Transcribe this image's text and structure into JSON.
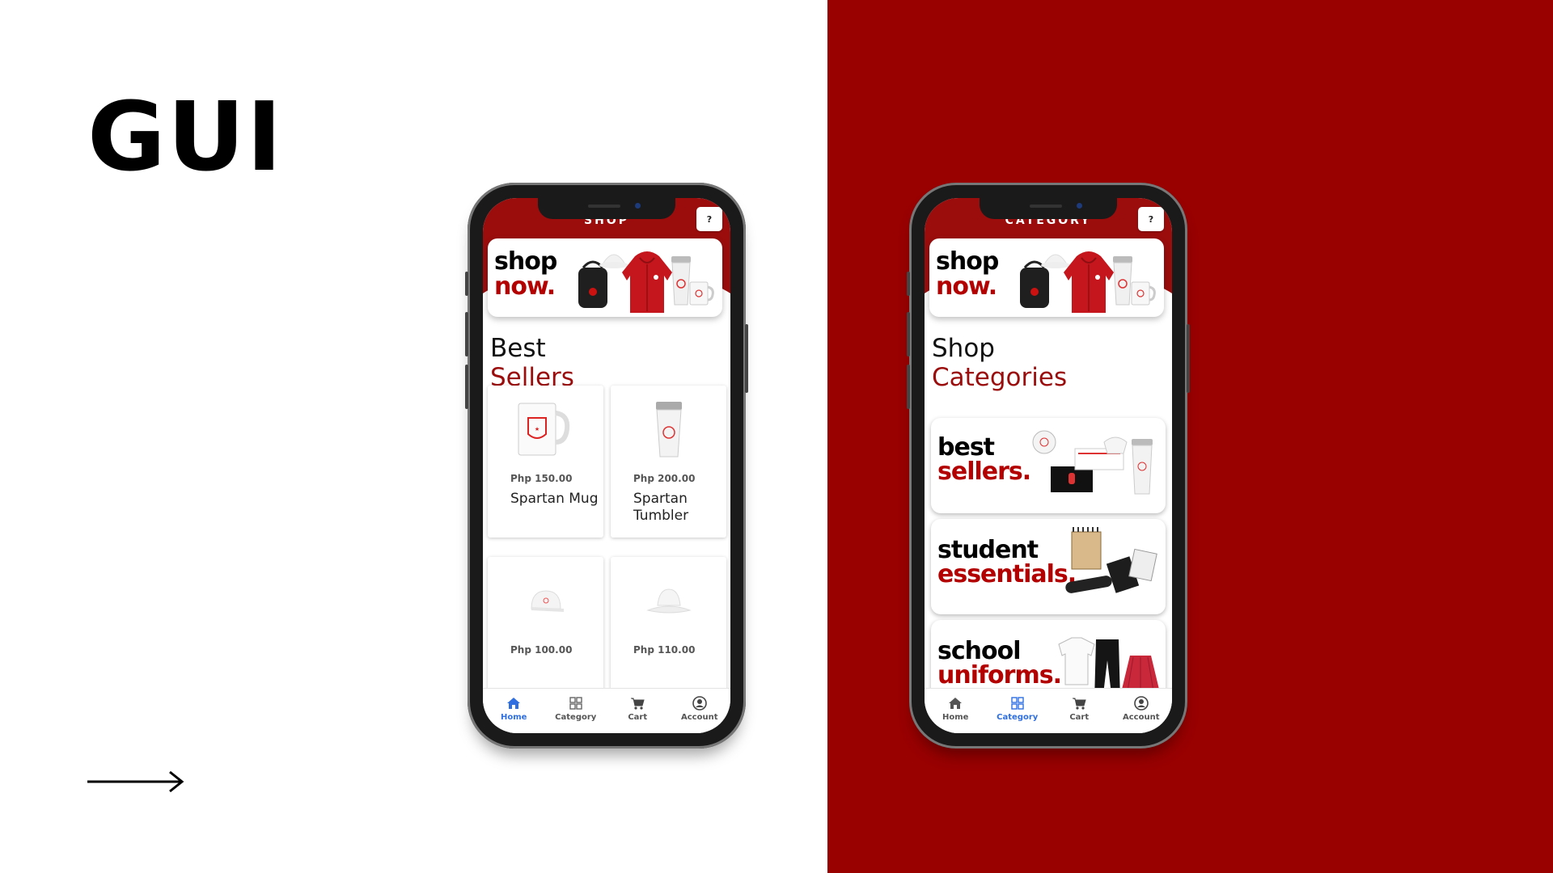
{
  "slide": {
    "title": "GUI"
  },
  "colors": {
    "brand_red": "#990000",
    "accent_blue": "#2f6fe0"
  },
  "shop_screen": {
    "header_title": "SHOP",
    "help_label": "?",
    "banner": {
      "line1": "shop",
      "line2": "now."
    },
    "section": {
      "line1": "Best",
      "line2": "Sellers"
    },
    "products": [
      {
        "price": "Php 150.00",
        "name": "Spartan Mug",
        "icon": "mug-icon"
      },
      {
        "price": "Php 200.00",
        "name": "Spartan Tumbler",
        "icon": "tumbler-icon"
      },
      {
        "price": "Php 100.00",
        "name": "",
        "icon": "cap-icon"
      },
      {
        "price": "Php 110.00",
        "name": "",
        "icon": "bucket-hat-icon"
      }
    ],
    "active_tab": "Home"
  },
  "category_screen": {
    "header_title": "CATEGORY",
    "help_label": "?",
    "banner": {
      "line1": "shop",
      "line2": "now."
    },
    "section": {
      "line1": "Shop",
      "line2": "Categories"
    },
    "categories": [
      {
        "line1": "best",
        "line2": "sellers."
      },
      {
        "line1": "student",
        "line2": "essentials."
      },
      {
        "line1": "school",
        "line2": "uniforms."
      }
    ],
    "active_tab": "Category"
  },
  "tabs": [
    {
      "label": "Home",
      "icon": "home-icon"
    },
    {
      "label": "Category",
      "icon": "grid-icon"
    },
    {
      "label": "Cart",
      "icon": "cart-icon"
    },
    {
      "label": "Account",
      "icon": "account-icon"
    }
  ]
}
